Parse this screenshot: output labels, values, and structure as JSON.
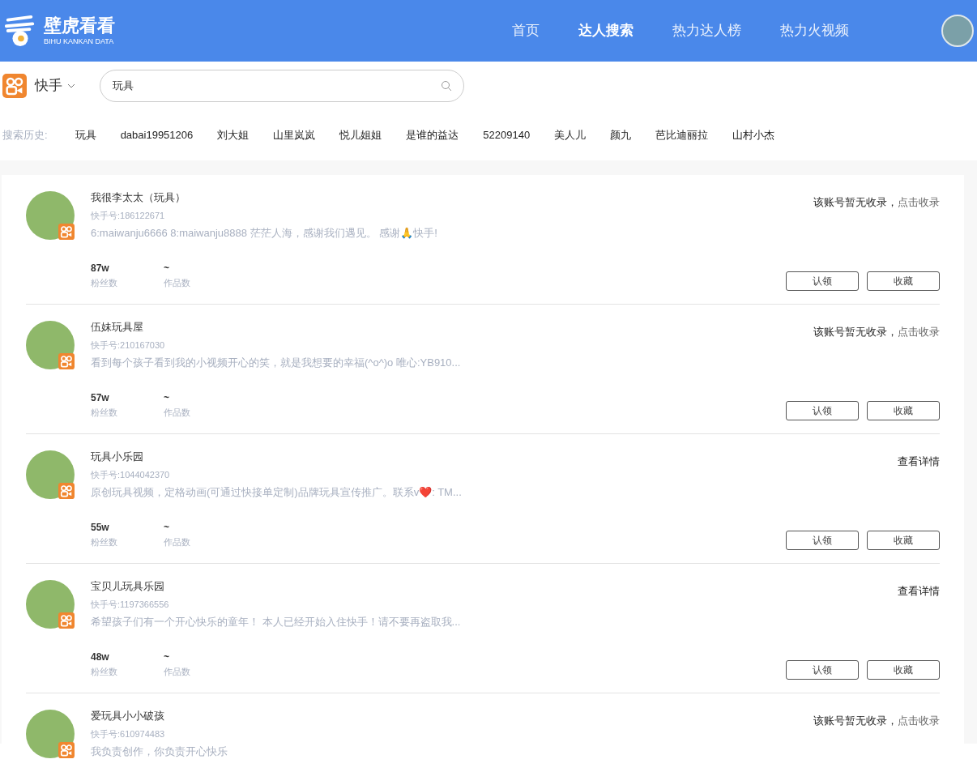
{
  "header": {
    "logo_title": "壁虎看看",
    "logo_subtitle": "BIHU KANKAN DATA",
    "nav": [
      {
        "label": "首页",
        "selected": false
      },
      {
        "label": "达人搜索",
        "selected": true
      },
      {
        "label": "热力达人榜",
        "selected": false
      },
      {
        "label": "热力火视频",
        "selected": false
      }
    ]
  },
  "search": {
    "platform": "快手",
    "value": "玩具"
  },
  "history": {
    "label": "搜索历史:",
    "items": [
      "玩具",
      "dabai19951206",
      "刘大姐",
      "山里岚岚",
      "悦儿姐姐",
      "是谁的益达",
      "52209140",
      "美人儿",
      "颜九",
      "芭比迪丽拉",
      "山村小杰"
    ]
  },
  "results": [
    {
      "name": "我很李太太（玩具）",
      "account": "快手号:186122671",
      "bio": "6:maiwanju6666 8:maiwanju8888 茫茫人海，感谢我们遇见。 感谢🙏快手!",
      "fans": "87w",
      "fans_label": "粉丝数",
      "works": "~",
      "works_label": "作品数",
      "status": {
        "kind": "uncollected",
        "text": "该账号暂无收录，",
        "link": "点击收录"
      },
      "buttons": [
        "认领",
        "收藏"
      ]
    },
    {
      "name": "伍妹玩具屋",
      "account": "快手号:210167030",
      "bio": "看到每个孩子看到我的小视频开心的笑，就是我想要的幸福(^o^)o 唯心:YB910...",
      "fans": "57w",
      "fans_label": "粉丝数",
      "works": "~",
      "works_label": "作品数",
      "status": {
        "kind": "uncollected",
        "text": "该账号暂无收录，",
        "link": "点击收录"
      },
      "buttons": [
        "认领",
        "收藏"
      ]
    },
    {
      "name": "玩具小乐园",
      "account": "快手号:1044042370",
      "bio": "原创玩具视频，定格动画(可通过快接单定制)品牌玩具宣传推广。联系v❤️: TM...",
      "fans": "55w",
      "fans_label": "粉丝数",
      "works": "~",
      "works_label": "作品数",
      "status": {
        "kind": "details",
        "text": "查看详情"
      },
      "buttons": [
        "认领",
        "收藏"
      ]
    },
    {
      "name": "宝贝儿玩具乐园",
      "account": "快手号:1197366556",
      "bio": "希望孩子们有一个开心快乐的童年！ 本人已经开始入住快手！请不要再盗取我...",
      "fans": "48w",
      "fans_label": "粉丝数",
      "works": "~",
      "works_label": "作品数",
      "status": {
        "kind": "details",
        "text": "查看详情"
      },
      "buttons": [
        "认领",
        "收藏"
      ]
    },
    {
      "name": "爱玩具小小破孩",
      "account": "快手号:610974483",
      "bio": "我负责创作，你负责开心快乐",
      "status": {
        "kind": "uncollected",
        "text": "该账号暂无收录，",
        "link": "点击收录"
      }
    }
  ]
}
